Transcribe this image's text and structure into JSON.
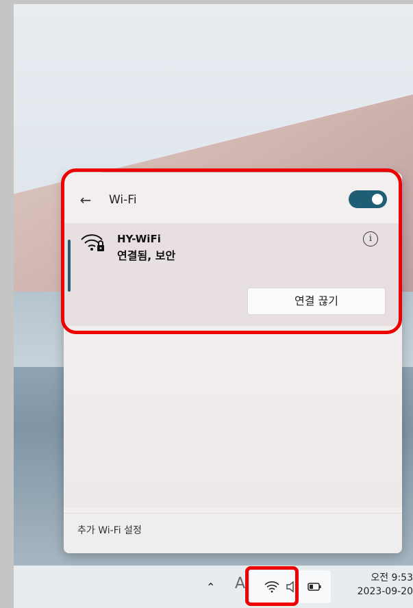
{
  "flyout": {
    "title": "Wi-Fi",
    "toggle_on": true,
    "network": {
      "name": "HY-WiFi",
      "status": "연결됨, 보안",
      "disconnect_label": "연결 끊기"
    },
    "more_settings": "추가 Wi-Fi 설정"
  },
  "taskbar": {
    "ime_label": "A",
    "time": "오전 9:53",
    "date": "2023-09-20"
  },
  "colors": {
    "accent": "#1f5e74",
    "highlight": "#e00000"
  },
  "icons": [
    "back-arrow-icon",
    "wifi-secured-icon",
    "info-icon",
    "chevron-up-icon",
    "wifi-icon",
    "volume-muted-icon",
    "battery-icon"
  ]
}
